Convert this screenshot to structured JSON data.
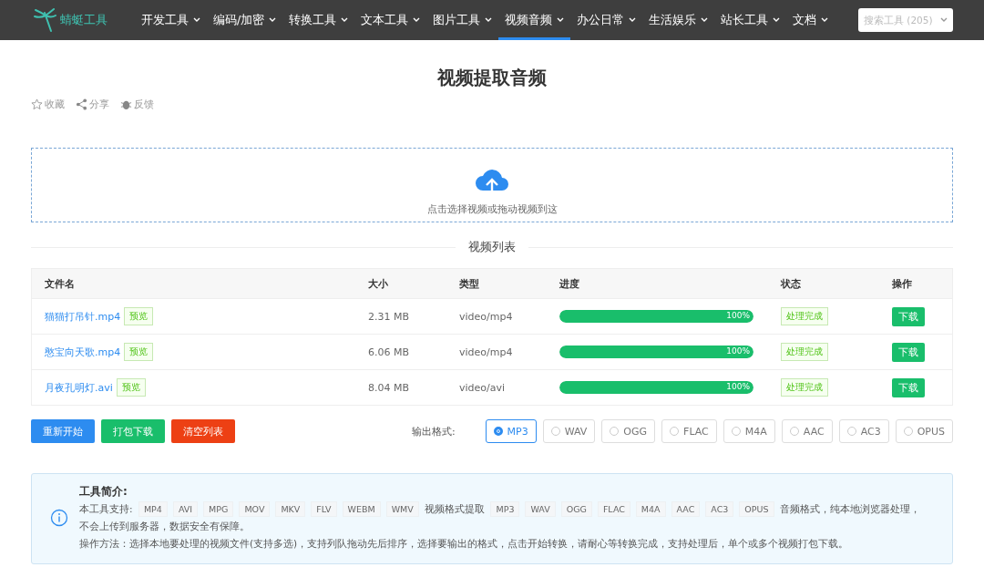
{
  "nav": {
    "logo": "蜻蜓工具",
    "items": [
      {
        "label": "开发工具",
        "selected": false
      },
      {
        "label": "编码/加密",
        "selected": false
      },
      {
        "label": "转换工具",
        "selected": false
      },
      {
        "label": "文本工具",
        "selected": false
      },
      {
        "label": "图片工具",
        "selected": false
      },
      {
        "label": "视频音频",
        "selected": true
      },
      {
        "label": "办公日常",
        "selected": false
      },
      {
        "label": "生活娱乐",
        "selected": false
      },
      {
        "label": "站长工具",
        "selected": false
      },
      {
        "label": "文档",
        "selected": false
      }
    ],
    "search": {
      "placeholder": "搜索工具 (205)"
    }
  },
  "page": {
    "title": "视频提取音频",
    "actions": [
      {
        "kind": "star",
        "label": "收藏"
      },
      {
        "kind": "share",
        "label": "分享"
      },
      {
        "kind": "feedback",
        "label": "反馈"
      }
    ]
  },
  "upload": {
    "hint": "点击选择视频或拖动视频到这"
  },
  "list_title": "视频列表",
  "table": {
    "columns": [
      "文件名",
      "大小",
      "类型",
      "进度",
      "状态",
      "操作"
    ],
    "rows": [
      {
        "name": "猫猫打吊针.mp4",
        "preview": "预览",
        "size": "2.31 MB",
        "type": "video/mp4",
        "level": 1,
        "progress": "100%",
        "status": "处理完成",
        "action": "下载"
      },
      {
        "name": "憨宝向天歌.mp4",
        "preview": "预览",
        "size": "6.06 MB",
        "type": "video/mp4",
        "level": 1,
        "progress": "100%",
        "status": "处理完成",
        "action": "下载"
      },
      {
        "name": "月夜孔明灯.avi",
        "preview": "预览",
        "size": "8.04 MB",
        "type": "video/avi",
        "level": 1,
        "progress": "100%",
        "status": "处理完成",
        "action": "下载"
      }
    ]
  },
  "buttons": [
    {
      "kind": "primary",
      "label": "重新开始"
    },
    {
      "kind": "success",
      "label": "打包下载"
    },
    {
      "kind": "danger",
      "label": "清空列表"
    }
  ],
  "output": {
    "label": "输出格式:",
    "formats": [
      {
        "label": "MP3",
        "selected": true
      },
      {
        "label": "WAV",
        "selected": false
      },
      {
        "label": "OGG",
        "selected": false
      },
      {
        "label": "FLAC",
        "selected": false
      },
      {
        "label": "M4A",
        "selected": false
      },
      {
        "label": "AAC",
        "selected": false
      },
      {
        "label": "AC3",
        "selected": false
      },
      {
        "label": "OPUS",
        "selected": false
      }
    ]
  },
  "intro": {
    "title": "工具简介:",
    "support_prefix": "本工具支持:",
    "video_formats": [
      "MP4",
      "AVI",
      "MPG",
      "MOV",
      "MKV",
      "FLV",
      "WEBM",
      "WMV"
    ],
    "video_suffix": "视频格式提取",
    "audio_formats": [
      "MP3",
      "WAV",
      "OGG",
      "FLAC",
      "M4A",
      "AAC",
      "AC3",
      "OPUS"
    ],
    "audio_suffix": "音频格式，纯本地浏览器处理，",
    "safety": "不会上传到服务器，数据安全有保障。",
    "usage": "操作方法：选择本地要处理的视频文件(支持多选)，支持列队拖动先后排序，选择要输出的格式，点击开始转换，请耐心等转换完成，支持处理后，单个或多个视频打包下载。"
  }
}
